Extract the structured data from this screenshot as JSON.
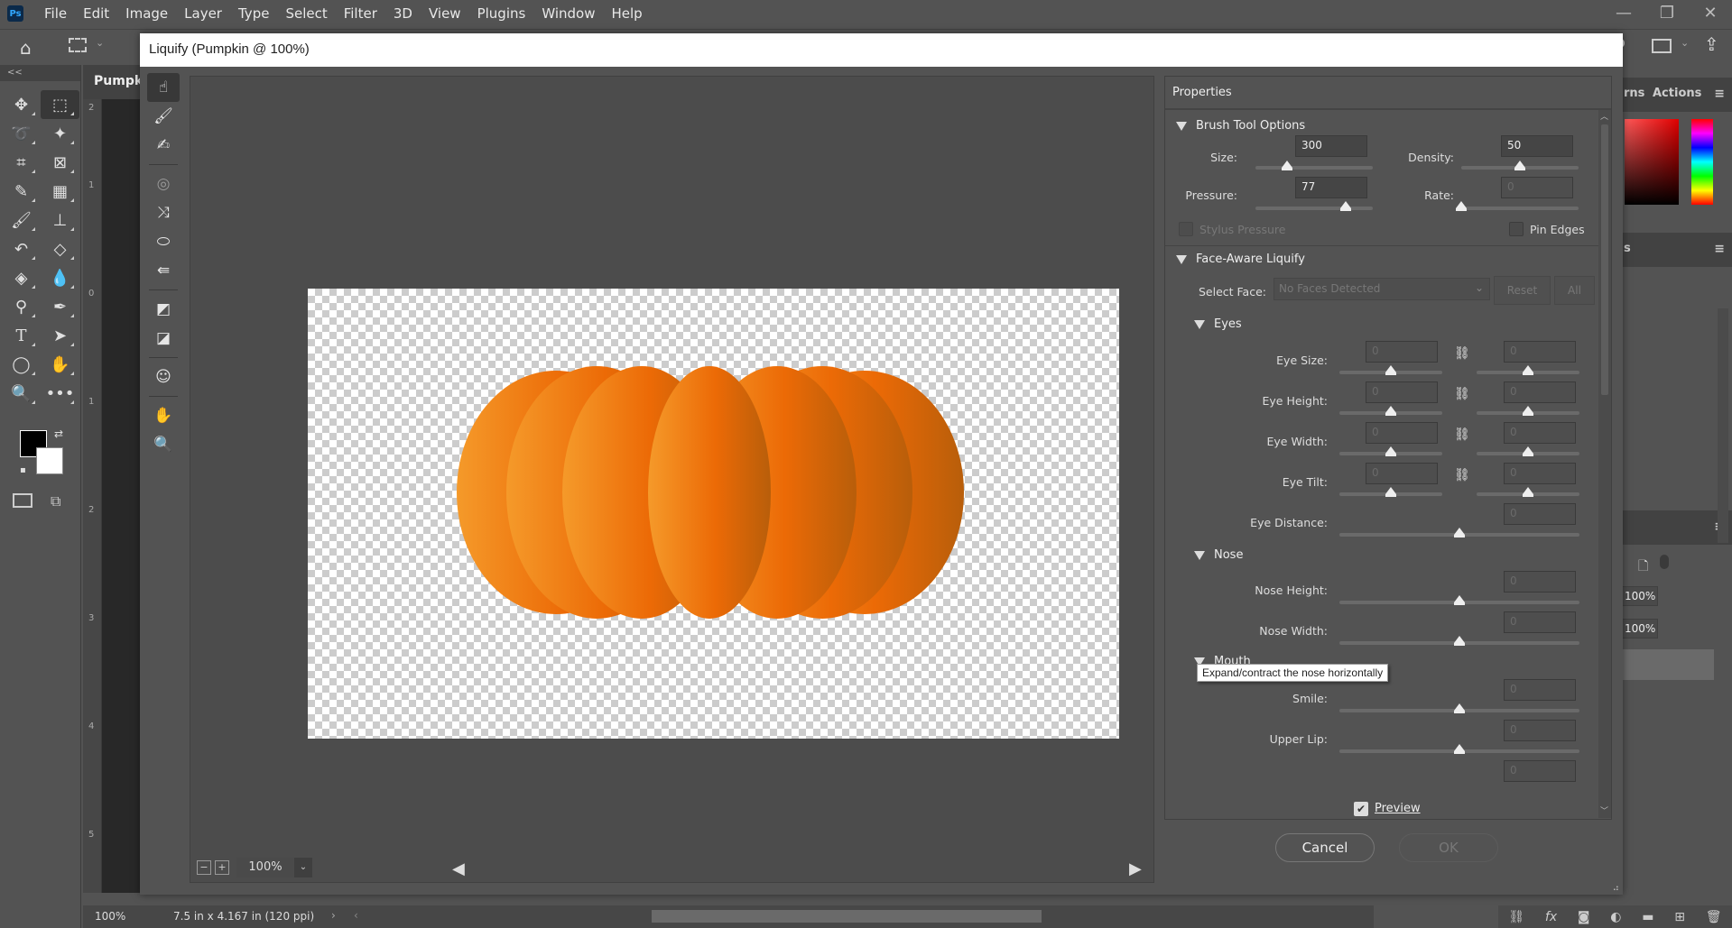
{
  "app": {
    "logo": "Ps"
  },
  "menu": [
    "File",
    "Edit",
    "Image",
    "Layer",
    "Type",
    "Select",
    "Filter",
    "3D",
    "View",
    "Plugins",
    "Window",
    "Help"
  ],
  "window_controls": {
    "minimize": "—",
    "restore": "❐",
    "close": "✕"
  },
  "document": {
    "tab_label": "Pumpkin",
    "ruler_labels": [
      "2",
      "1",
      "0",
      "1",
      "2",
      "3",
      "4",
      "5"
    ],
    "status_zoom": "100%",
    "status_info": "7.5 in x 4.167 in (120 ppi)"
  },
  "toolbar": {
    "collapse": "<<"
  },
  "dialog": {
    "title": "Liquify (Pumpkin @ 100%)",
    "zoom": {
      "minus": "−",
      "plus": "+",
      "value": "100%",
      "dropdown": "⌄"
    },
    "properties": {
      "title": "Properties",
      "brush": {
        "heading": "Brush Tool Options",
        "size_label": "Size:",
        "size_value": "300",
        "size_slider": 0.27,
        "density_label": "Density:",
        "density_value": "50",
        "density_slider": 0.5,
        "pressure_label": "Pressure:",
        "pressure_value": "77",
        "pressure_slider": 0.77,
        "rate_label": "Rate:",
        "rate_value": "0",
        "rate_slider": 0.0,
        "stylus_label": "Stylus Pressure",
        "pin_label": "Pin Edges"
      },
      "face": {
        "heading": "Face-Aware Liquify",
        "select_label": "Select Face:",
        "select_value": "No Faces Detected",
        "reset_label": "Reset",
        "all_label": "All",
        "eyes_heading": "Eyes",
        "eye_size": "Eye Size:",
        "eye_height": "Eye Height:",
        "eye_width": "Eye Width:",
        "eye_tilt": "Eye Tilt:",
        "eye_distance": "Eye Distance:",
        "nose_heading": "Nose",
        "nose_height": "Nose Height:",
        "nose_width": "Nose Width:",
        "mouth_heading": "Mouth",
        "smile": "Smile:",
        "upper_lip": "Upper Lip:",
        "zero": "0"
      },
      "tooltip": "Expand/contract the nose horizontally"
    },
    "preview_label": "Preview",
    "preview_checked": true,
    "cancel_label": "Cancel",
    "ok_label": "OK"
  },
  "right_panels": {
    "tab1": "rns",
    "tab2": "Actions",
    "tab3": "s",
    "opacity": "100%",
    "fill": "100%"
  },
  "colors": {
    "accent_orange": "#f07a10",
    "panel_bg": "#535353",
    "canvas_checker": "#cccccc"
  }
}
